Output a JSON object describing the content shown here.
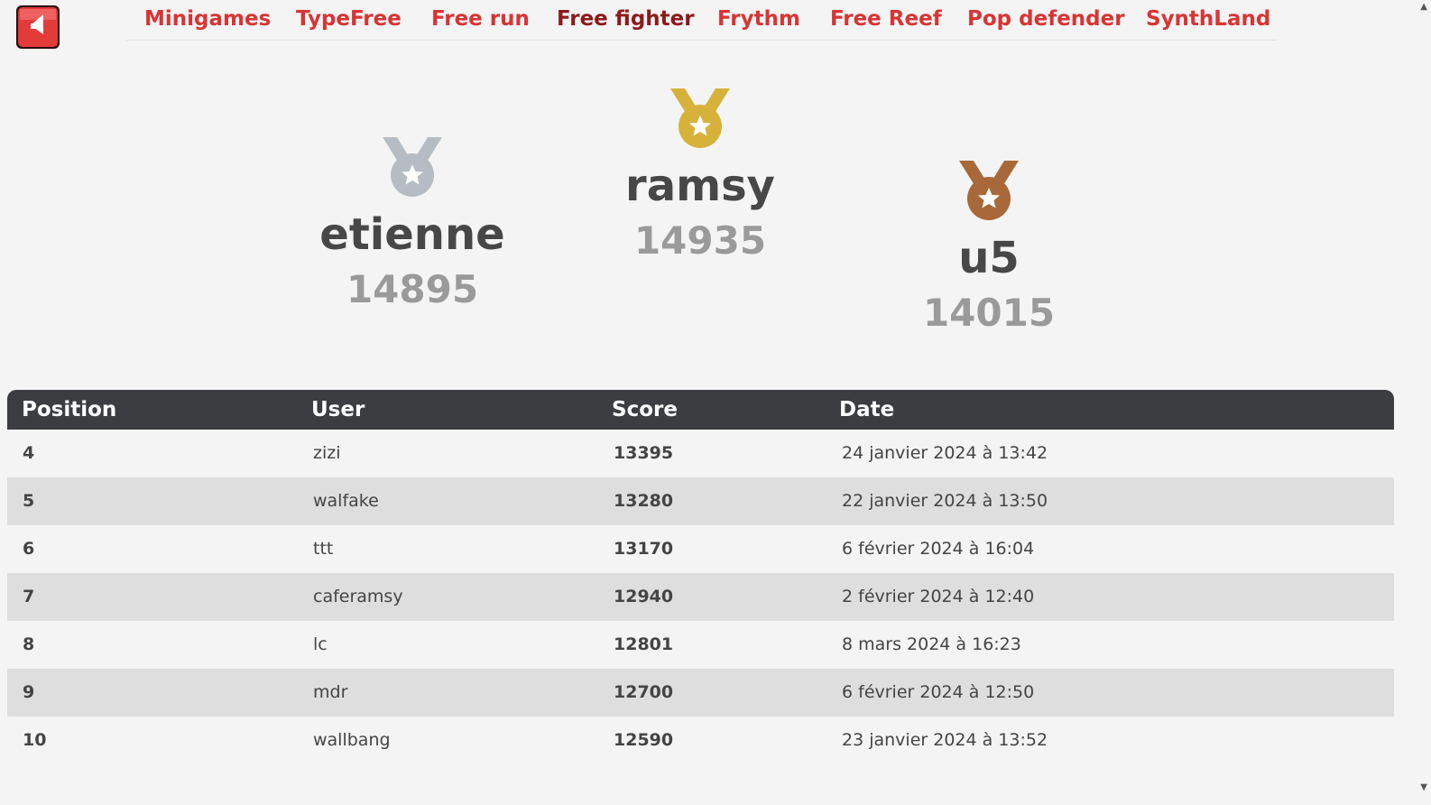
{
  "nav": {
    "items": [
      {
        "label": "Minigames"
      },
      {
        "label": "TypeFree"
      },
      {
        "label": "Free run"
      },
      {
        "label": "Free fighter"
      },
      {
        "label": "Frythm"
      },
      {
        "label": "Free Reef"
      },
      {
        "label": "Pop defender"
      },
      {
        "label": "SynthLand"
      }
    ],
    "active": "Free fighter"
  },
  "podium": {
    "first": {
      "name": "ramsy",
      "score": "14935",
      "medal": "gold-medal-icon"
    },
    "second": {
      "name": "etienne",
      "score": "14895",
      "medal": "silver-medal-icon"
    },
    "third": {
      "name": "u5",
      "score": "14015",
      "medal": "bronze-medal-icon"
    }
  },
  "colors": {
    "nav_link": "#d93434",
    "nav_active": "#8c1b1b",
    "gold": "#d7b23a",
    "silver": "#b5bcc3",
    "bronze": "#a8683a",
    "table_header": "#3c3d41"
  },
  "table": {
    "headers": {
      "position": "Position",
      "user": "User",
      "score": "Score",
      "date": "Date"
    },
    "rows": [
      {
        "position": "4",
        "user": "zizi",
        "score": "13395",
        "date": "24 janvier 2024 à 13:42"
      },
      {
        "position": "5",
        "user": "walfake",
        "score": "13280",
        "date": "22 janvier 2024 à 13:50"
      },
      {
        "position": "6",
        "user": "ttt",
        "score": "13170",
        "date": "6 février 2024 à 16:04"
      },
      {
        "position": "7",
        "user": "caferamsy",
        "score": "12940",
        "date": "2 février 2024 à 12:40"
      },
      {
        "position": "8",
        "user": "lc",
        "score": "12801",
        "date": "8 mars 2024 à 16:23"
      },
      {
        "position": "9",
        "user": "mdr",
        "score": "12700",
        "date": "6 février 2024 à 12:50"
      },
      {
        "position": "10",
        "user": "wallbang",
        "score": "12590",
        "date": "23 janvier 2024 à 13:52"
      }
    ]
  }
}
